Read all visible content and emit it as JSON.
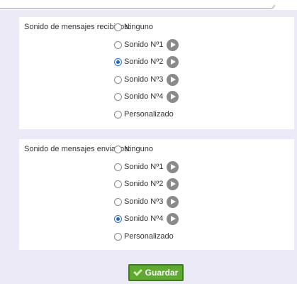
{
  "received": {
    "label": "Sonido de mensajes recibidos:",
    "options": [
      {
        "label": "Ninguno",
        "checked": false,
        "play": false
      },
      {
        "label": "Sonido Nº1",
        "checked": false,
        "play": true
      },
      {
        "label": "Sonido Nº2",
        "checked": true,
        "play": true
      },
      {
        "label": "Sonido Nº3",
        "checked": false,
        "play": true
      },
      {
        "label": "Sonido Nº4",
        "checked": false,
        "play": true
      },
      {
        "label": "Personalizado",
        "checked": false,
        "play": false
      }
    ]
  },
  "sent": {
    "label": "Sonido de mensajes enviados:",
    "options": [
      {
        "label": "Ninguno",
        "checked": false,
        "play": false
      },
      {
        "label": "Sonido Nº1",
        "checked": false,
        "play": true
      },
      {
        "label": "Sonido Nº2",
        "checked": false,
        "play": true
      },
      {
        "label": "Sonido Nº3",
        "checked": false,
        "play": true
      },
      {
        "label": "Sonido Nº4",
        "checked": true,
        "play": true
      },
      {
        "label": "Personalizado",
        "checked": false,
        "play": false
      }
    ]
  },
  "save_button": {
    "label": "Guardar",
    "icon": "check-icon"
  },
  "colors": {
    "accent_green": "#5fa831",
    "radio_selected": "#1f63d0",
    "play_icon": "#8a8a8a",
    "page_bg": "#eceaf6"
  }
}
